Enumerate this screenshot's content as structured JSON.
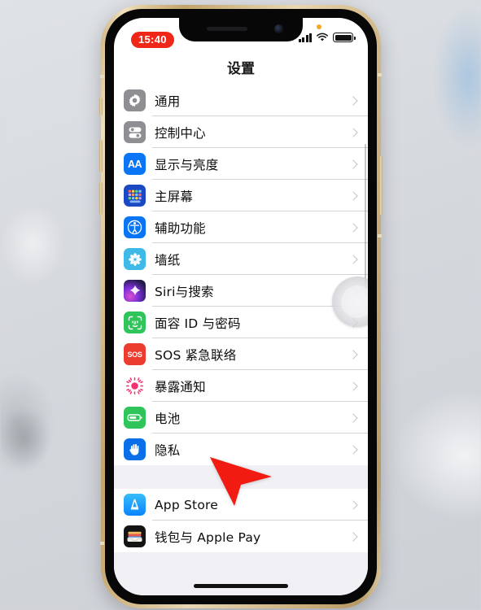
{
  "device": {
    "frame_color": "#d9c292",
    "screen_bg": "#ffffff"
  },
  "status_bar": {
    "time": "15:40",
    "recording_pill_color": "#f02718",
    "icons": [
      "orange-mic-dot",
      "cellular-signal-icon",
      "wifi-icon",
      "battery-icon"
    ]
  },
  "nav": {
    "title": "设置"
  },
  "settings": {
    "groups": [
      {
        "rows": [
          {
            "label": "通用",
            "icon": "gear-icon",
            "color": "#8e8e93"
          },
          {
            "label": "控制中心",
            "icon": "control-center-icon",
            "color": "#8e8e93"
          },
          {
            "label": "显示与亮度",
            "icon": "display-brightness-icon",
            "color": "#0a76f6"
          },
          {
            "label": "主屏幕",
            "icon": "home-screen-icon",
            "color": "#1b49c4"
          },
          {
            "label": "辅助功能",
            "icon": "accessibility-icon",
            "color": "#0a76f6"
          },
          {
            "label": "墙纸",
            "icon": "wallpaper-icon",
            "color": "#3fb9e8"
          },
          {
            "label": "Siri与搜索",
            "icon": "siri-icon",
            "color": "#7b2fd8"
          },
          {
            "label": "面容 ID 与密码",
            "icon": "face-id-icon",
            "color": "#2fc55a"
          },
          {
            "label": "SOS 紧急联络",
            "icon": "sos-icon",
            "color": "#ec3b2f"
          },
          {
            "label": "暴露通知",
            "icon": "exposure-notification-icon",
            "color": "#f4336d"
          },
          {
            "label": "电池",
            "icon": "battery-settings-icon",
            "color": "#2fc55a"
          },
          {
            "label": "隐私",
            "icon": "privacy-hand-icon",
            "color": "#0a6fe8"
          }
        ]
      },
      {
        "rows": [
          {
            "label": "App Store",
            "icon": "app-store-icon",
            "color": "#0a84ff"
          },
          {
            "label": "钱包与 Apple Pay",
            "icon": "wallet-icon",
            "color": "#141414"
          }
        ]
      }
    ]
  },
  "overlays": {
    "assistive_touch": "assistive-touch-button",
    "pointer": "red-arrow-cursor",
    "pointer_color": "#f21b12",
    "scroll_indicator": "scroll-indicator"
  }
}
